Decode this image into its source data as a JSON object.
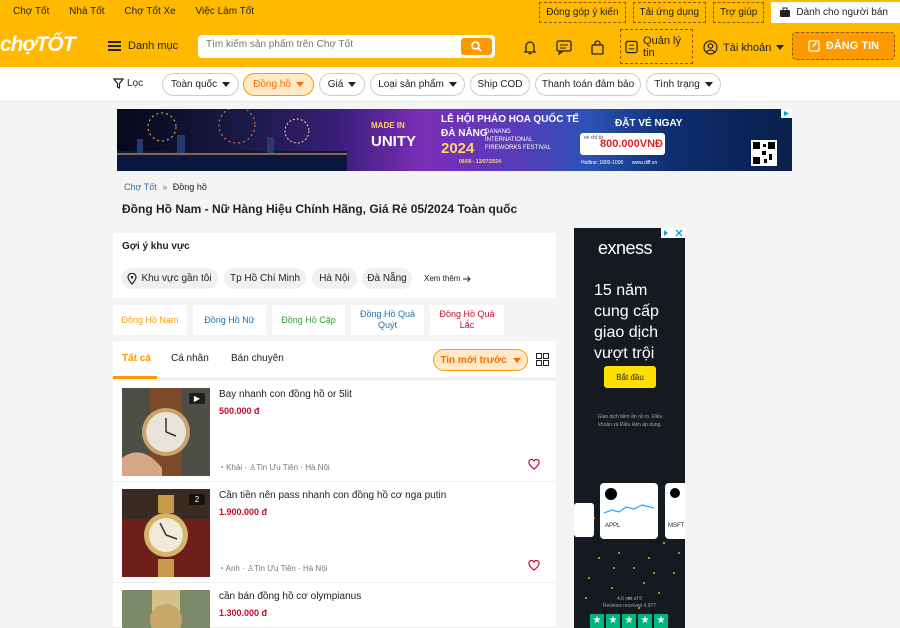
{
  "topnav": {
    "links": [
      "Chợ Tốt",
      "Nhà Tốt",
      "Chợ Tốt Xe",
      "Việc Làm Tốt"
    ],
    "feedback": "Đóng góp ý kiến",
    "download": "Tải ứng dụng",
    "help": "Trợ giúp",
    "seller": "Dành cho người bán"
  },
  "header": {
    "logo": "chợTỐT",
    "menu": "Danh mục",
    "search_placeholder": "Tìm kiếm sản phẩm trên Chợ Tốt",
    "manage": "Quản lý tin",
    "account": "Tài khoản",
    "post": "ĐĂNG TIN"
  },
  "filters": {
    "filter": "Lọc",
    "chips": [
      "Toàn quốc",
      "Đồng hồ",
      "Giá",
      "Loại sản phẩm",
      "Ship COD",
      "Thanh toán đảm bảo",
      "Tình trạng"
    ]
  },
  "banner": {
    "t1": "LỄ HỘI PHÁO HOA QUỐC TẾ",
    "t2": "ĐÀ NẴNG",
    "year": "2024",
    "t3": "DANANG",
    "t4": "INTERNATIONAL",
    "t5": "FIREWORKS FESTIVAL",
    "dates": "08/06 - 13/07/2024",
    "cta": "ĐẶT VÉ NGAY",
    "price_label": "vé chỉ từ",
    "price": "800.000VNĐ",
    "hotline": "Hotline: 1800-1000",
    "web": "www.diff.vn",
    "made": "MADE IN",
    "unity": "UNITY"
  },
  "breadcrumb": {
    "home": "Chợ Tốt",
    "sep": "»",
    "current": "Đồng hồ"
  },
  "page_title": "Đồng Hồ Nam - Nữ Hàng Hiệu Chính Hãng, Giá Rẻ 05/2024 Toàn quốc",
  "regions": {
    "heading": "Gợi ý khu vực",
    "chips": [
      "Khu vực gần tôi",
      "Tp Hồ Chí Minh",
      "Hà Nội",
      "Đà Nẵng"
    ],
    "more": "Xem thêm"
  },
  "categories": [
    "Đồng Hồ Nam",
    "Đồng Hồ Nữ",
    "Đồng Hồ Cặp",
    "Đồng Hồ Quả Quýt",
    "Đồng Hồ Quả Lắc"
  ],
  "tabs": {
    "all": "Tất cả",
    "personal": "Cá nhân",
    "pro": "Bán chuyên",
    "sort": "Tin mới trước"
  },
  "listings": [
    {
      "title": "Bay nhanh con đồng hồ or 5lit",
      "price": "500.000 đ",
      "seller": "Khải",
      "badge": "Tin Ưu Tiên",
      "location": "Hà Nội",
      "sep": "·",
      "media": "▶"
    },
    {
      "title": "Cần tiền nên pass nhanh con đồng hồ cơ nga putin",
      "price": "1.900.000 đ",
      "seller": "Anh",
      "badge": "Tin Ưu Tiên",
      "location": "Hà Nội",
      "sep": "·",
      "media": "2"
    },
    {
      "title": "cần bán đồng hồ cơ olympianus",
      "price": "1.300.000 đ"
    }
  ],
  "ad": {
    "brand": "exness",
    "line1": "15 năm",
    "line2": "cung cấp",
    "line3": "giao dịch",
    "line4": "vượt trội",
    "cta": "Bắt đầu",
    "fine": "Giao dịch tiềm ẩn rủi ro. Điều khoản và Điều kiện áp dụng.",
    "ticker1": "APPL",
    "ticker2": "MSFT",
    "rating": "4.6 out of 5",
    "reviews": "Reviews received 4,977"
  },
  "colors": {
    "brand": "#ffba00",
    "accent": "#fe9900",
    "price": "#c90927",
    "link": "#2672b3"
  }
}
